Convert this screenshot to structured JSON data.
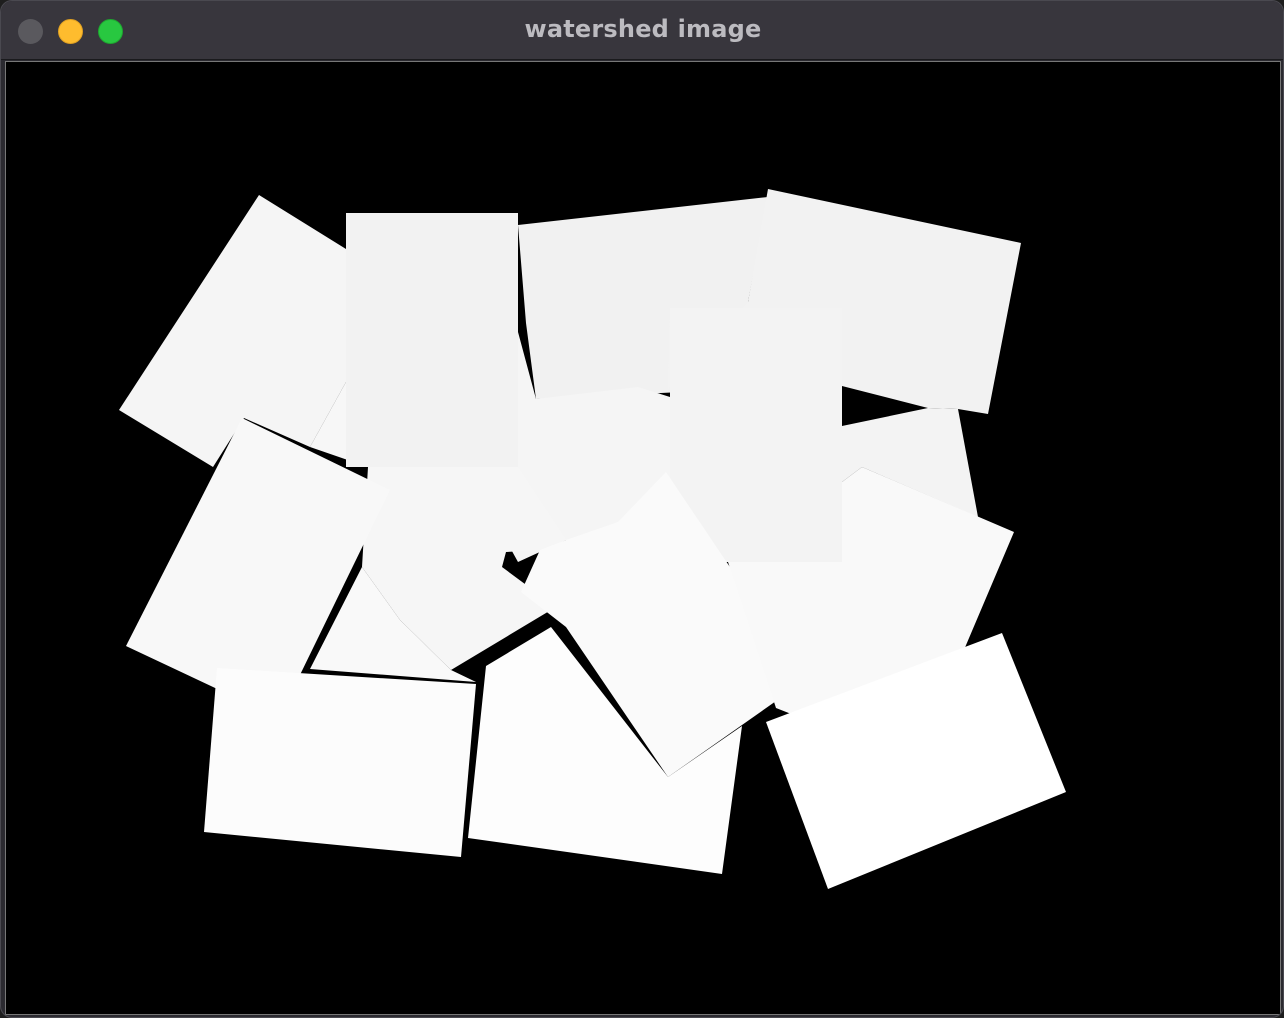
{
  "window": {
    "title": "watershed image"
  },
  "canvas": {
    "background": "#000000",
    "description_icon": "segmented-regions-image"
  },
  "colors": {
    "titlebar": "#38363d",
    "title_text": "#bcbbc0",
    "close": "#5a595e",
    "minimize": "#febc2e",
    "zoom": "#28c840"
  }
}
